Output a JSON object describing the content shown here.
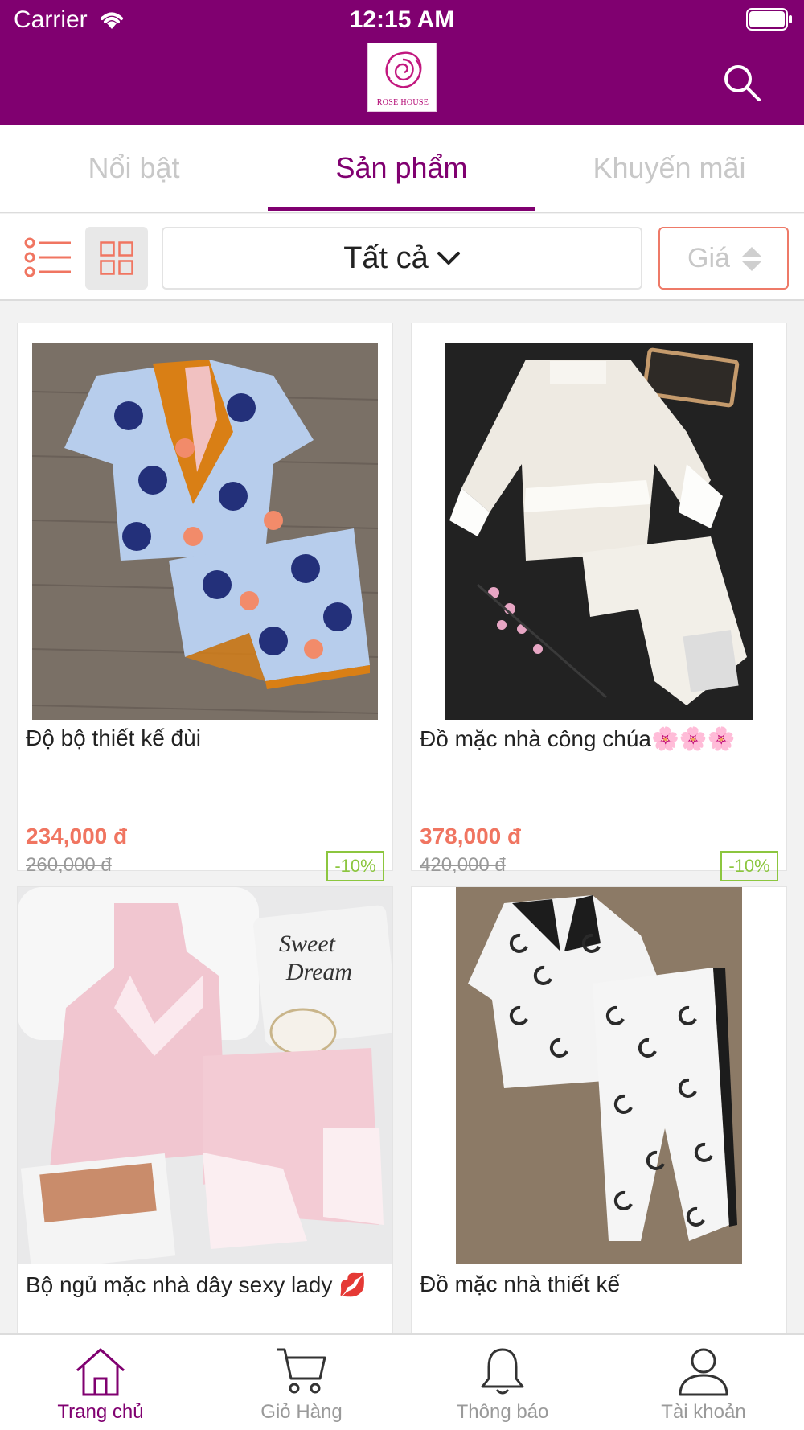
{
  "status_bar": {
    "carrier": "Carrier",
    "time": "12:15 AM"
  },
  "header": {
    "logo_text": "ROSE HOUSE"
  },
  "tabs": [
    {
      "label": "Nổi bật",
      "active": false
    },
    {
      "label": "Sản phẩm",
      "active": true
    },
    {
      "label": "Khuyến mãi",
      "active": false
    }
  ],
  "toolbar": {
    "category": "Tất cả",
    "sort_label": "Giá"
  },
  "products": [
    {
      "name": "Độ bộ thiết kế đùi",
      "price": "234,000 đ",
      "old_price": "260,000 đ",
      "discount": "-10%"
    },
    {
      "name": "Đồ mặc nhà công chúa🌸🌸🌸",
      "price": "378,000 đ",
      "old_price": "420,000 đ",
      "discount": "-10%"
    },
    {
      "name": "Bộ ngủ mặc nhà dây sexy lady 💋",
      "price": "",
      "old_price": "",
      "discount": ""
    },
    {
      "name": "Đồ mặc nhà thiết kế",
      "price": "",
      "old_price": "",
      "discount": ""
    }
  ],
  "bottom_nav": [
    {
      "label": "Trang chủ",
      "icon": "home-icon",
      "active": true
    },
    {
      "label": "Giỏ Hàng",
      "icon": "cart-icon",
      "active": false
    },
    {
      "label": "Thông báo",
      "icon": "bell-icon",
      "active": false
    },
    {
      "label": "Tài khoản",
      "icon": "user-icon",
      "active": false
    }
  ],
  "colors": {
    "brand": "#800070",
    "price": "#f07561",
    "discount": "#8cc63f",
    "sort_border": "#ee7a68"
  }
}
